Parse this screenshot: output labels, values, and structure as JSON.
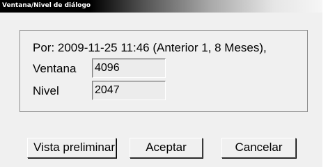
{
  "window": {
    "title": "Ventana/Nivel de diálogo"
  },
  "info": {
    "text": "Por: 2009-11-25 11:46 (Anterior 1, 8 Meses),"
  },
  "fields": {
    "window_label": "Ventana",
    "window_value": "4096",
    "level_label": "Nivel",
    "level_value": "2047"
  },
  "buttons": {
    "preview_label": "Vista preliminar",
    "accept_label": "Aceptar",
    "cancel_label": "Cancelar"
  },
  "colors": {
    "dialog_background": "#f0f0f0",
    "titlebar_dark": "#000000",
    "input_background": "#ececec"
  }
}
